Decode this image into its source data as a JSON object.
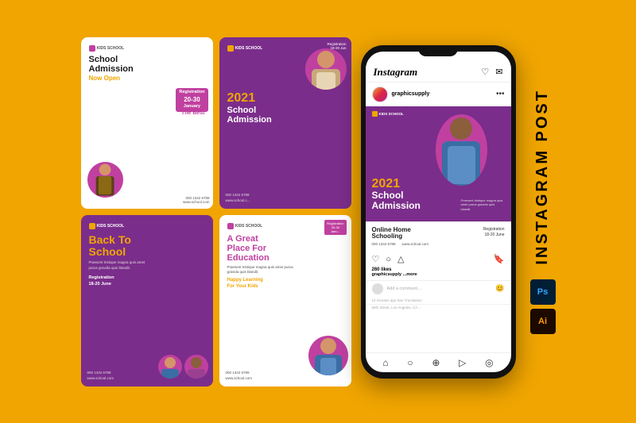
{
  "page": {
    "title": "Instagram Post",
    "background_color": "#F0A500"
  },
  "brand": {
    "name": "KIDS SCHOOL",
    "icon_color": "#C040A0"
  },
  "card1": {
    "title": "School Admission",
    "subtitle": "Now Open",
    "tagline": "Your Kids\nDeserve\nThe Best",
    "reg_label": "Registration",
    "reg_dates": "20-30",
    "reg_month": "January",
    "phone": "000 1342 6789",
    "website": "www.school.com",
    "background": "#ffffff"
  },
  "card2": {
    "year": "2021",
    "title": "School\nAdmission",
    "reg_label": "Registration\n18-20 Jun",
    "phone": "000 1342 6789",
    "website": "www.school.c...",
    "background": "#7B2D8B"
  },
  "card3": {
    "title": "Back To\nSchool",
    "desc": "Praesent tristique magna quis amet purus gravida quis blandit.",
    "reg_label": "Registration\n18-20 June",
    "phone": "000 1342 6789",
    "website": "www.school.com",
    "background": "#7B2D8B"
  },
  "card4": {
    "title": "A Great\nPlace For\nEducation",
    "desc": "Praesent tristique magna quis amet purus gravida quis blandit.",
    "subtitle": "Happy Learning\nFor Your Kids",
    "reg_label": "Registration\n20-30 Janu...",
    "phone": "000 1342 6789",
    "website": "www.school.com",
    "background": "#ffffff"
  },
  "phone": {
    "app_name": "Instagram",
    "username": "graphicsupply",
    "ad_year": "2021",
    "ad_title": "School\nAdmission",
    "ad_desc": "Praesent tristique magna quis amet purus gravida quis blandit.",
    "second_card_title": "Online Home\nSchooling",
    "second_reg": "Registration\n18-20 June",
    "second_phone": "000 1342 6789",
    "second_website": "www.school.com",
    "likes": "260 likes",
    "caption_user": "graphicsupply",
    "caption_text": "...more",
    "comment_placeholder": "Add a comment...",
    "time_ago": "10 minutes ago  See Translation",
    "location": "56th Street, Los Angeles, CA..."
  },
  "sidebar": {
    "label": "INSTAGRAM POST"
  },
  "software": {
    "ps_label": "Ps",
    "ai_label": "Ai"
  }
}
